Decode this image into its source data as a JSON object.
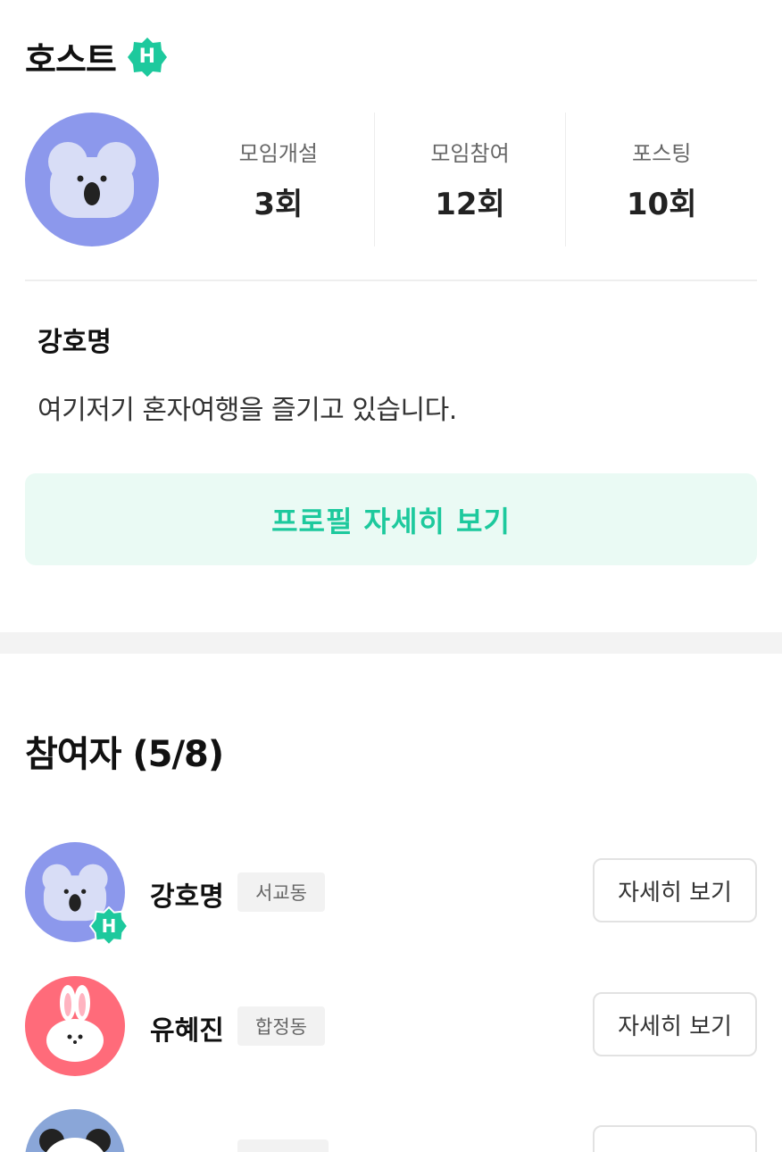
{
  "host_section": {
    "title": "호스트",
    "badge_letter": "H",
    "avatar_icon": "koala-avatar-icon",
    "stats": [
      {
        "label": "모임개설",
        "value": "3회"
      },
      {
        "label": "모임참여",
        "value": "12회"
      },
      {
        "label": "포스팅",
        "value": "10회"
      }
    ],
    "name": "강호명",
    "bio": "여기저기 혼자여행을 즐기고 있습니다.",
    "profile_button": "프로필 자세히 보기"
  },
  "participants": {
    "title": "참여자 (5/8)",
    "items": [
      {
        "name": "강호명",
        "location": "서교동",
        "button": "자세히 보기",
        "avatar_icon": "koala-avatar-icon",
        "is_host": true
      },
      {
        "name": "유혜진",
        "location": "합정동",
        "button": "자세히 보기",
        "avatar_icon": "rabbit-avatar-icon",
        "is_host": false
      },
      {
        "name": "",
        "location": "",
        "button": "",
        "avatar_icon": "panda-avatar-icon",
        "is_host": false
      }
    ]
  },
  "colors": {
    "accent": "#1dc99d",
    "accent_bg": "#eafaf4",
    "koala_bg": "#8c98ec",
    "rabbit_bg": "#ff6b7a",
    "panda_bg": "#8aa6d8"
  }
}
